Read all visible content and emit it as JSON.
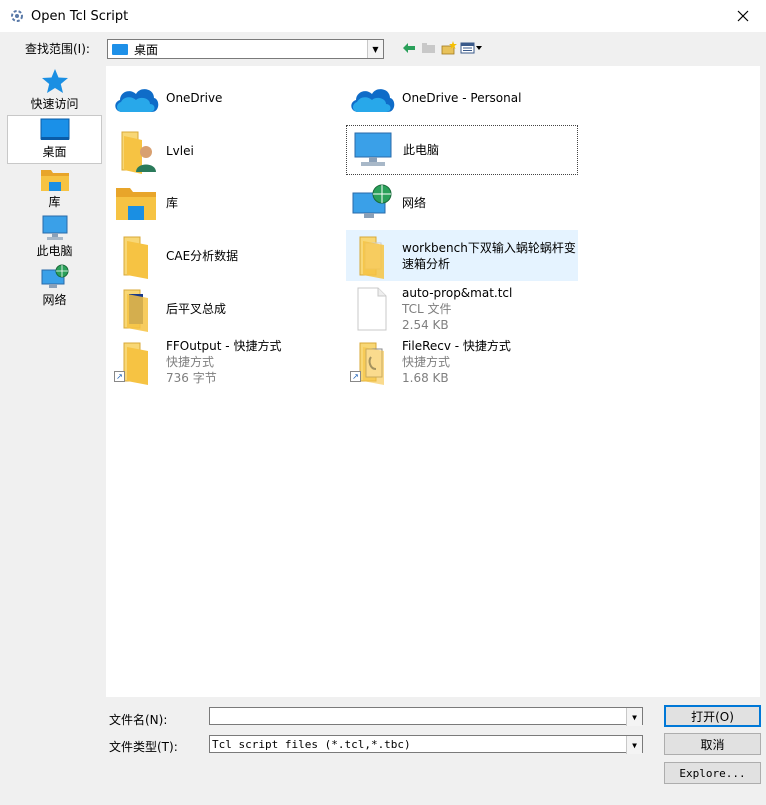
{
  "window": {
    "title": "Open Tcl Script"
  },
  "lookin": {
    "label": "查找范围(I):",
    "value": "桌面"
  },
  "places": [
    {
      "label": "快速访问",
      "icon": "star-icon"
    },
    {
      "label": "桌面",
      "icon": "desktop-icon"
    },
    {
      "label": "库",
      "icon": "library-icon"
    },
    {
      "label": "此电脑",
      "icon": "computer-icon"
    },
    {
      "label": "网络",
      "icon": "network-icon"
    }
  ],
  "items": [
    {
      "name": "OneDrive",
      "icon": "onedrive-icon"
    },
    {
      "name": "OneDrive - Personal",
      "icon": "onedrive-icon"
    },
    {
      "name": "Lvlei",
      "icon": "user-folder-icon"
    },
    {
      "name": "此电脑",
      "icon": "computer-icon"
    },
    {
      "name": "库",
      "icon": "library-icon"
    },
    {
      "name": "网络",
      "icon": "network-icon"
    },
    {
      "name": "CAE分析数据",
      "icon": "folder-icon"
    },
    {
      "name_line1": "workbench下双输入蜗轮蜗杆变",
      "name_line2": "速箱分析",
      "icon": "folder-icon"
    },
    {
      "name": "后平叉总成",
      "icon": "folder-icon"
    },
    {
      "name": "auto-prop&mat.tcl",
      "type": "TCL 文件",
      "size": "2.54 KB",
      "icon": "file-icon"
    },
    {
      "name": "FFOutput - 快捷方式",
      "type": "快捷方式",
      "size": "736 字节",
      "icon": "shortcut-folder-icon"
    },
    {
      "name": "FileRecv - 快捷方式",
      "type": "快捷方式",
      "size": "1.68 KB",
      "icon": "shortcut-folder-icon"
    }
  ],
  "filename": {
    "label": "文件名(N):",
    "value": ""
  },
  "filetype": {
    "label": "文件类型(T):",
    "value": "Tcl script files (*.tcl,*.tbc)"
  },
  "buttons": {
    "open": "打开(O)",
    "cancel": "取消",
    "explore": "Explore..."
  },
  "colors": {
    "accent": "#0078d7",
    "folder": "#f8d775",
    "hover": "#e5f3ff"
  }
}
